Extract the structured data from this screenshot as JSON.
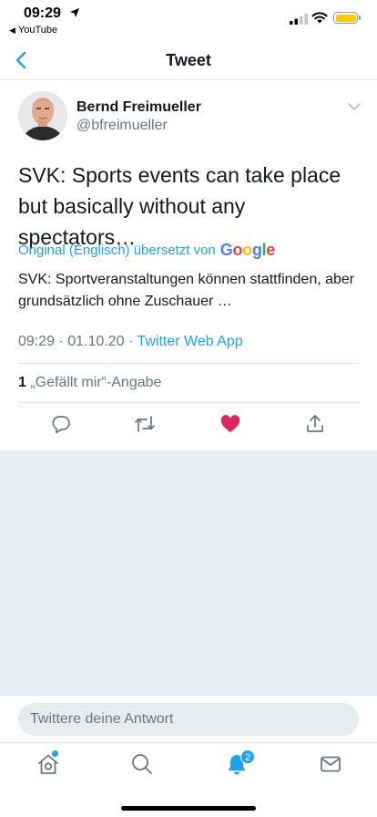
{
  "status_bar": {
    "time": "09:29",
    "back_app": "YouTube"
  },
  "header": {
    "title": "Tweet"
  },
  "tweet": {
    "author_name": "Bernd Freimueller",
    "author_handle": "@bfreimueller",
    "text": "SVK: Sports events can take place but basically without any spectators…",
    "translation_label": "Original (Englisch) übersetzt von",
    "translation_provider": "Google",
    "translated_text": "SVK: Sportveranstaltungen können stattfinden, aber grundsätzlich ohne Zuschauer …",
    "timestamp": "09:29 · 01.10.20 · ",
    "source": "Twitter Web App",
    "like_count": "1",
    "like_label": "„Gefällt mir“-Angabe"
  },
  "reply": {
    "placeholder": "Twittere deine Antwort"
  },
  "tab_bar": {
    "notification_count": "2"
  },
  "colors": {
    "accent": "#1da1f2",
    "like": "#e0245e",
    "secondary_text": "#657786",
    "background_gray": "#e6ecf0"
  },
  "icons": [
    "location-arrow-icon",
    "signal-icon",
    "wifi-icon",
    "battery-icon",
    "back-chevron-icon",
    "caret-down-icon",
    "reply-icon",
    "retweet-icon",
    "like-icon",
    "share-icon",
    "home-icon",
    "search-icon",
    "notifications-icon",
    "messages-icon"
  ]
}
